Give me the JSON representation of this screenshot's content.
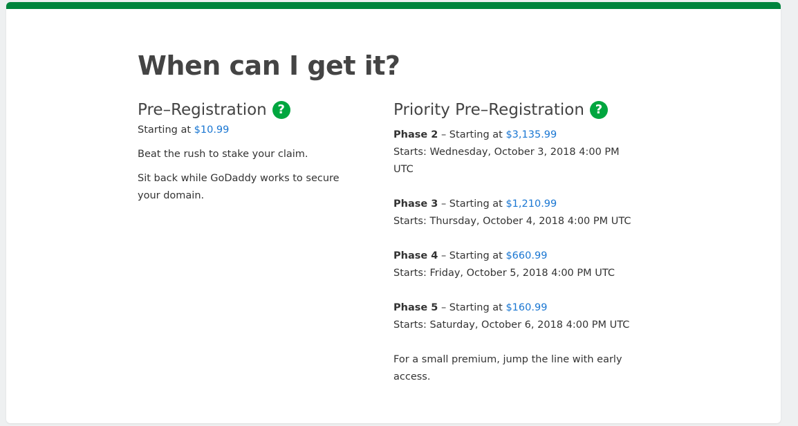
{
  "title": "When can I get it?",
  "pre_registration": {
    "heading": "Pre–Registration",
    "help_icon": "question-mark",
    "starting_prefix": "Starting at",
    "price": "$10.99",
    "line1": "Beat the rush to stake your claim.",
    "line2_a": "Sit back while GoDaddy works to secure",
    "line2_b": "your domain."
  },
  "priority": {
    "heading": "Priority Pre–Registration",
    "help_icon": "question-mark",
    "phases": [
      {
        "name": "Phase 2",
        "sep": " – Starting at ",
        "price": "$3,135.99",
        "start_a": "Starts: Wednesday, October 3, 2018 4:00 PM",
        "start_b": "UTC"
      },
      {
        "name": "Phase 3",
        "sep": " – Starting at ",
        "price": "$1,210.99",
        "start_a": "Starts: Thursday, October 4, 2018 4:00 PM UTC"
      },
      {
        "name": "Phase 4",
        "sep": " – Starting at ",
        "price": "$660.99",
        "start_a": "Starts: Friday, October 5, 2018 4:00 PM UTC"
      },
      {
        "name": "Phase 5",
        "sep": " – Starting at ",
        "price": "$160.99",
        "start_a": "Starts: Saturday, October 6, 2018 4:00 PM UTC"
      }
    ],
    "closing_a": "For a small premium, jump the line with early",
    "closing_b": "access."
  },
  "colors": {
    "accent_green": "#00843d",
    "help_green": "#00a63f",
    "price_blue": "#1976d2",
    "text": "#444444"
  }
}
